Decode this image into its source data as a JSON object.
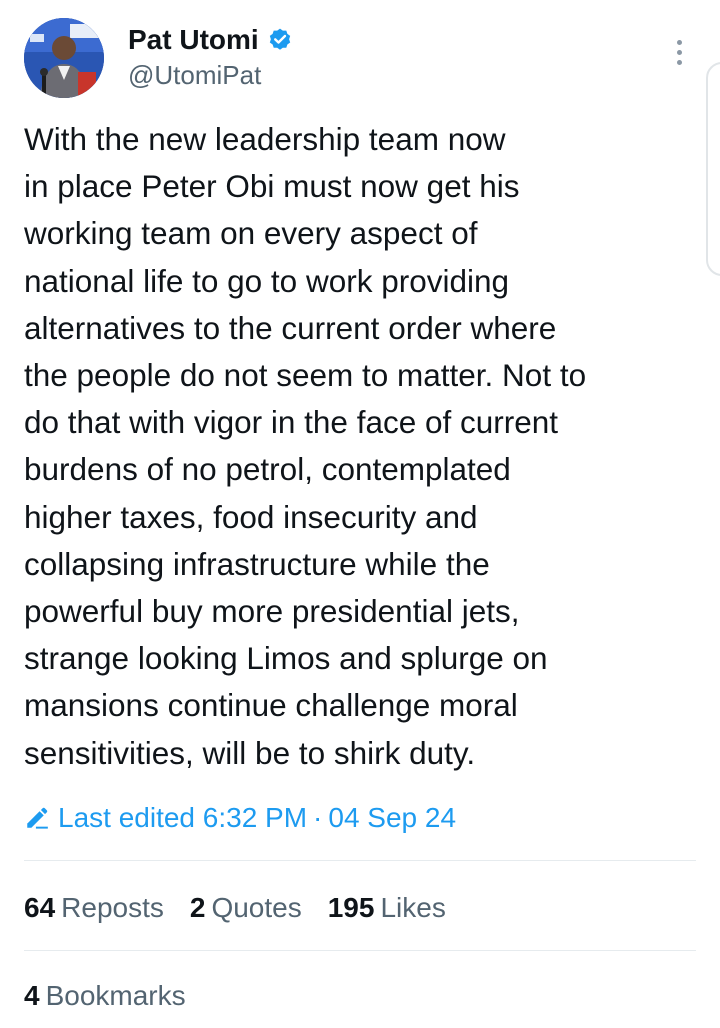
{
  "author": {
    "display_name": "Pat Utomi",
    "handle": "@UtomiPat",
    "verified": true,
    "avatar_icon": "profile-photo-speaker-at-podium"
  },
  "tweet": {
    "lines": [
      "With the new leadership team now",
      "in place Peter Obi must now get his",
      "working team on every aspect of",
      "national life to go to work providing",
      "alternatives to the current order where",
      "the people do not seem to matter. Not to",
      "do that with vigor in the face of current",
      "burdens of no petrol, contemplated",
      "higher taxes, food insecurity and",
      "collapsing infrastructure while the",
      "powerful buy more presidential jets,",
      "strange looking Limos and splurge on",
      "mansions continue challenge moral",
      "sensitivities, will be to shirk duty."
    ]
  },
  "edited": {
    "label": "Last edited 6:32 PM",
    "separator": "·",
    "date": "04 Sep 24"
  },
  "stats": {
    "reposts": {
      "count": "64",
      "label": "Reposts"
    },
    "quotes": {
      "count": "2",
      "label": "Quotes"
    },
    "likes": {
      "count": "195",
      "label": "Likes"
    },
    "bookmarks": {
      "count": "4",
      "label": "Bookmarks"
    }
  },
  "colors": {
    "accent": "#1d9bf0",
    "text_primary": "#0f1419",
    "text_secondary": "#536471",
    "divider": "#e6ebee"
  },
  "icons": {
    "verified": "verified-badge-icon",
    "more": "more-options-icon",
    "edit": "pencil-edit-icon"
  }
}
